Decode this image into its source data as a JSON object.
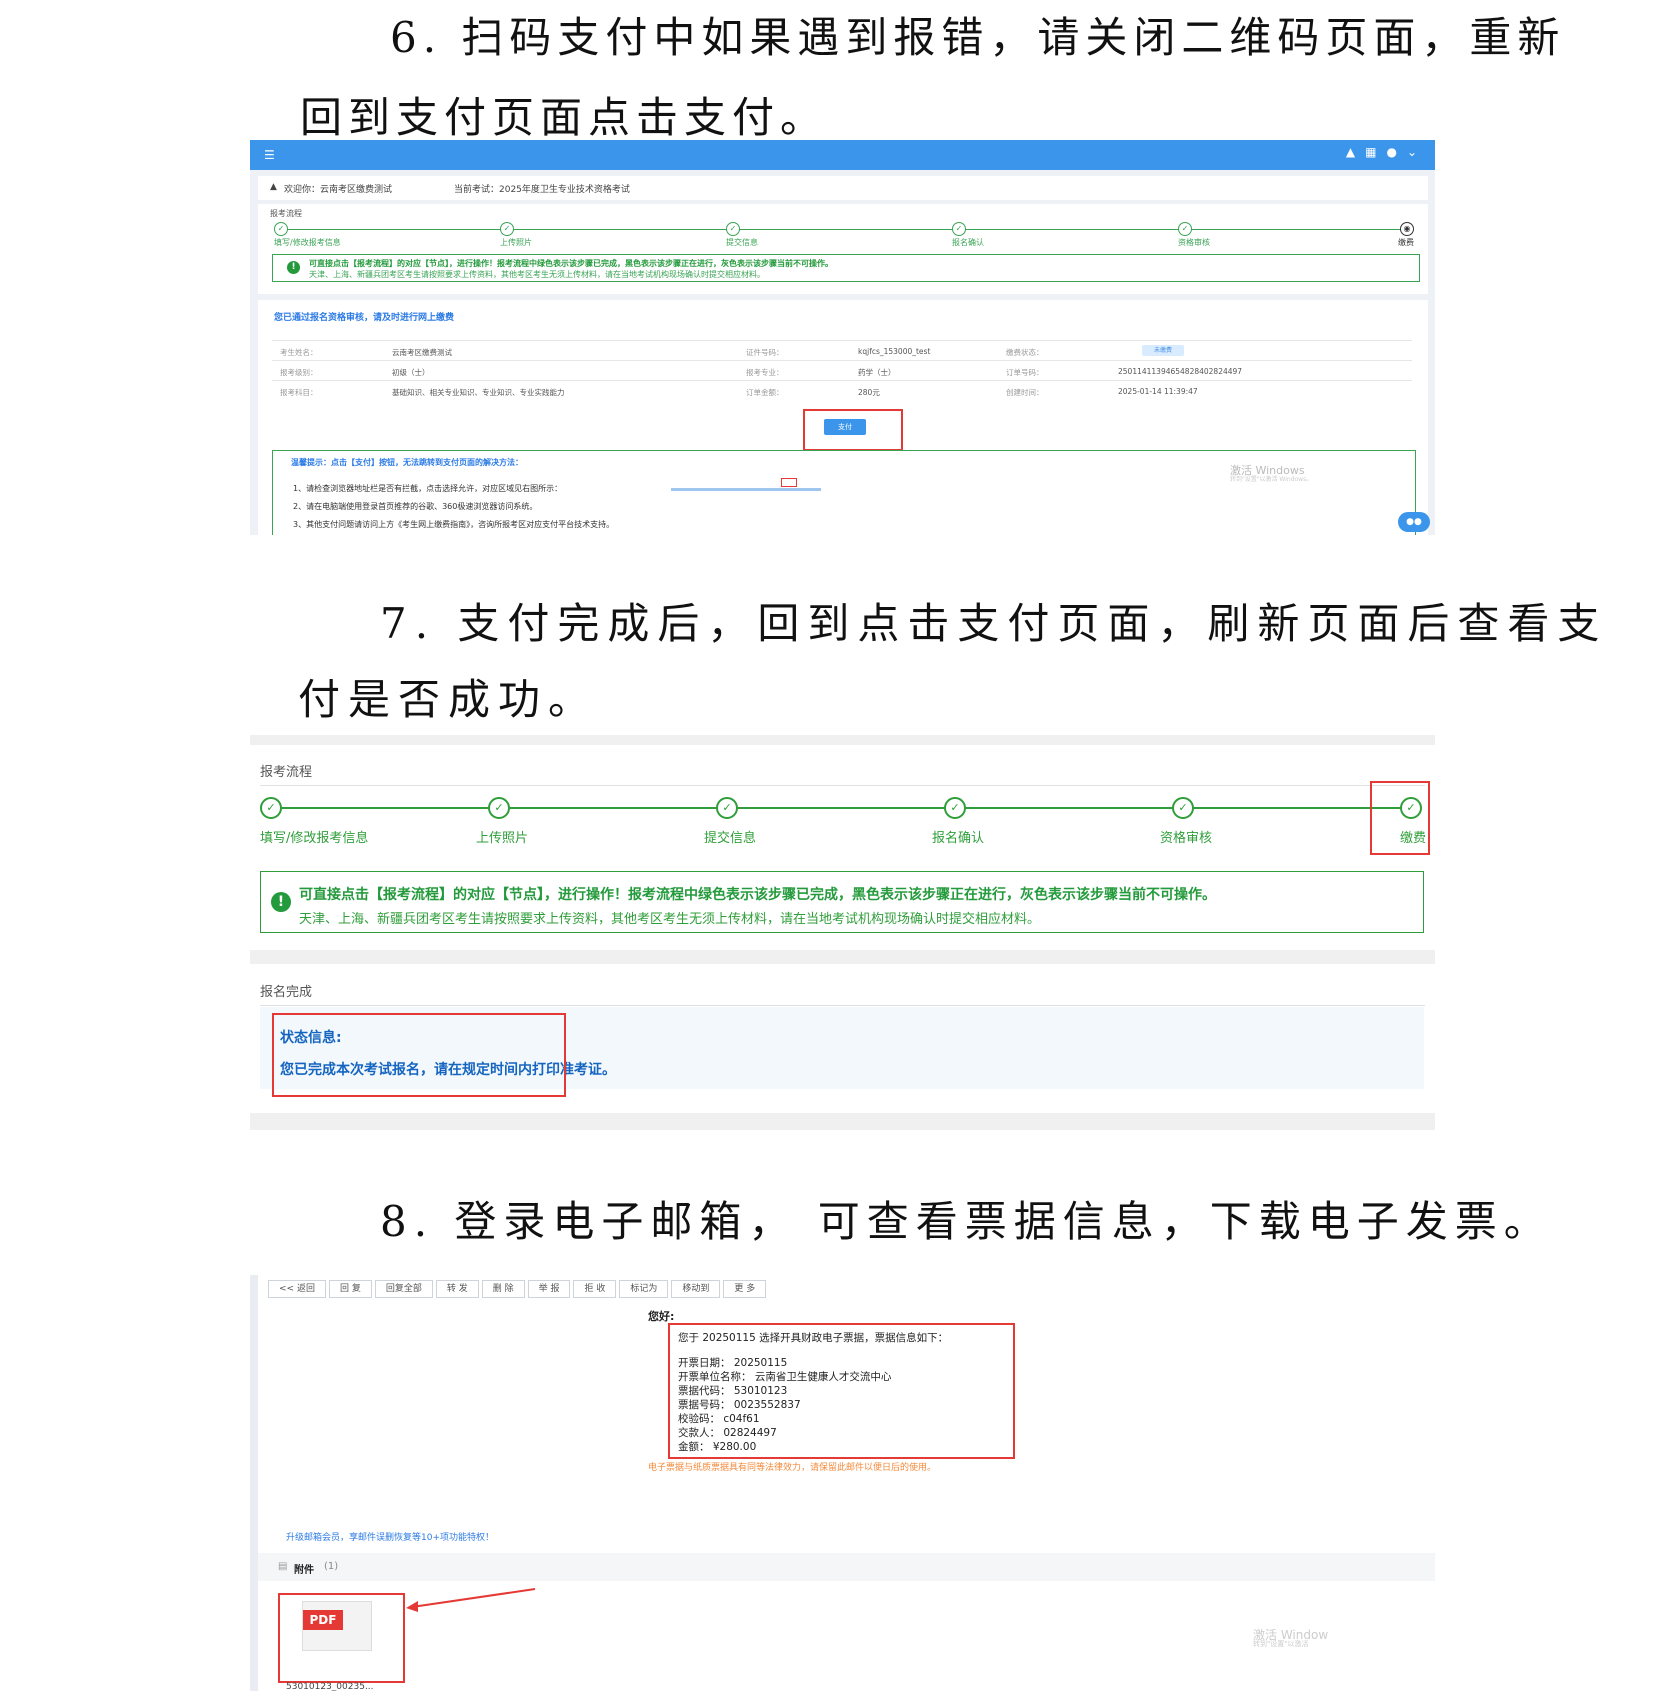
{
  "step6": {
    "line1": "6. 扫码支付中如果遇到报错，请关闭二维码页面，重新",
    "line2": "回到支付页面点击支付。"
  },
  "shot1": {
    "welcome": "欢迎你：云南考区缴费测试",
    "current_exam": "当前考试：2025年度卫生专业技术资格考试",
    "flow_title": "报考流程",
    "steps": [
      "填写/修改报考信息",
      "上传照片",
      "提交信息",
      "报名确认",
      "资格审核",
      "缴费"
    ],
    "tip_line1": "可直接点击【报考流程】的对应【节点】，进行操作！报考流程中绿色表示该步骤已完成，黑色表示该步骤正在进行，灰色表示该步骤当前不可操作。",
    "tip_line2": "天津、上海、新疆兵团考区考生请按照要求上传资料，其他考区考生无须上传材料，请在当地考试机构现场确认时提交相应材料。",
    "heading": "您已通过报名资格审核，请及时进行网上缴费",
    "rows": [
      {
        "k1": "考生姓名：",
        "v1": "云南考区缴费测试",
        "k2": "证件号码：",
        "v2": "kqjfcs_153000_test",
        "k3": "缴费状态：",
        "v3": "未缴费"
      },
      {
        "k1": "报考级别：",
        "v1": "初级（士）",
        "k2": "报考专业：",
        "v2": "药学（士）",
        "k3": "订单号码：",
        "v3": "2501141139465482840282449​7"
      },
      {
        "k1": "报考科目：",
        "v1": "基础知识、相关专业知识、专业知识、专业实践能力",
        "k2": "订单金额：",
        "v2": "280元",
        "k3": "创建时间：",
        "v3": "2025-01-14 11:39:47"
      }
    ],
    "pay_button": "支付",
    "help_title": "温馨提示：点击【支付】按钮，无法跳转到支付页面的解决方法：",
    "help_items": [
      "1、请检查浏览器地址栏是否有拦截，点击选择允许，对应区域见右图所示：",
      "2、请在电脑端使用登录首页推荐的谷歌、360极速浏览器访问系统。",
      "3、其他支付问题请访问上方《考生网上缴费指南》，咨询所报考区对应支付平台技术支持。"
    ],
    "watermark1": "激活 Windows",
    "watermark2": "转到\"设置\"以激活 Windows。"
  },
  "step7": {
    "line1": "7. 支付完成后，回到点击支付页面，刷新页面后查看支",
    "line2": "付是否成功。"
  },
  "shot2": {
    "flow_title": "报考流程",
    "steps": [
      "填写/修改报考信息",
      "上传照片",
      "提交信息",
      "报名确认",
      "资格审核",
      "缴费"
    ],
    "tip_line1": "可直接点击【报考流程】的对应【节点】，进行操作！报考流程中绿色表示该步骤已完成，黑色表示该步骤正在进行，灰色表示该步骤当前不可操作。",
    "tip_line2": "天津、上海、新疆兵团考区考生请按照要求上传资料，其他考区考生无须上传材料，请在当地考试机构现场确认时提交相应材料。",
    "complete_title": "报名完成",
    "status_label": "状态信息:",
    "status_text": "您已完成本次考试报名，请在规定时间内打印准考证。"
  },
  "step8": {
    "line1": "8. 登录电子邮箱， 可查看票据信息，下载电子发票。"
  },
  "shot3": {
    "toolbar": [
      "<< 返回",
      "回 复",
      "回复全部",
      "转 发",
      "删 除",
      "举 报",
      "拒 收",
      "标记为",
      "移动到",
      "更 多"
    ],
    "hello": "您好:",
    "intro": "您于 20250115 选择开具财政电子票据，票据信息如下：",
    "fields": [
      "开票日期： 20250115",
      "开票单位名称： 云南省卫生健康人才交流中心",
      "票据代码： 53010123",
      "票据号码： 0023552837",
      "校验码： c04f61",
      "交款人： 02824497",
      "金额： ¥280.00"
    ],
    "warning": "电子票据与纸质票据具有同等法律效力，请保留此邮件以便日后的使用。",
    "upgrade": "升级邮箱会员，享邮件误删恢复等10+项功能特权！",
    "attach_label": "附件",
    "attach_count": "(1)",
    "pdf_label": "PDF",
    "filename": "53010123_00235...",
    "watermark1": "激活 Window",
    "watermark2": "转到\"设置\"以激活"
  }
}
